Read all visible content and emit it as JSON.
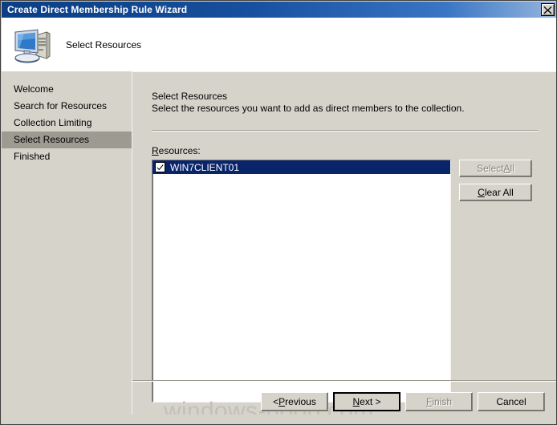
{
  "window": {
    "title": "Create Direct Membership Rule Wizard",
    "close_icon": "close-icon",
    "accent_titlebar_start": "#0b3e84",
    "accent_titlebar_end": "#96b6de",
    "face_color": "#d6d3cb",
    "selection_color": "#0a246a"
  },
  "header": {
    "icon": "computer-icon",
    "title": "Select Resources"
  },
  "sidebar": {
    "items": [
      {
        "label": "Welcome",
        "active": false
      },
      {
        "label": "Search for Resources",
        "active": false
      },
      {
        "label": "Collection Limiting",
        "active": false
      },
      {
        "label": "Select Resources",
        "active": true
      },
      {
        "label": "Finished",
        "active": false
      }
    ]
  },
  "content": {
    "step_title": "Select Resources",
    "step_description": "Select the resources you want to add as direct members to the collection.",
    "resources_label_accel": "R",
    "resources_label_rest": "esources:",
    "list": {
      "rows": [
        {
          "label": "WIN7CLIENT01",
          "checked": true,
          "selected": true
        }
      ]
    },
    "side_buttons": [
      {
        "name": "select-all-button",
        "label_accel_before": "Select ",
        "label_accel": "A",
        "label_accel_after": "ll",
        "disabled": true
      },
      {
        "name": "clear-all-button",
        "label_accel_before": "",
        "label_accel": "C",
        "label_accel_after": "lear All",
        "disabled": false
      }
    ]
  },
  "footer": {
    "buttons": [
      {
        "name": "previous-button",
        "before": "< ",
        "accel": "P",
        "after": "revious",
        "disabled": false,
        "default": false
      },
      {
        "name": "next-button",
        "before": "",
        "accel": "N",
        "after": "ext >",
        "disabled": false,
        "default": true
      },
      {
        "name": "finish-button",
        "before": "",
        "accel": "F",
        "after": "inish",
        "disabled": true,
        "default": false
      },
      {
        "name": "cancel-button",
        "before": "",
        "accel": "",
        "after": "Cancel",
        "disabled": false,
        "default": false
      }
    ]
  },
  "watermark": {
    "text": "windows-noob.com"
  }
}
